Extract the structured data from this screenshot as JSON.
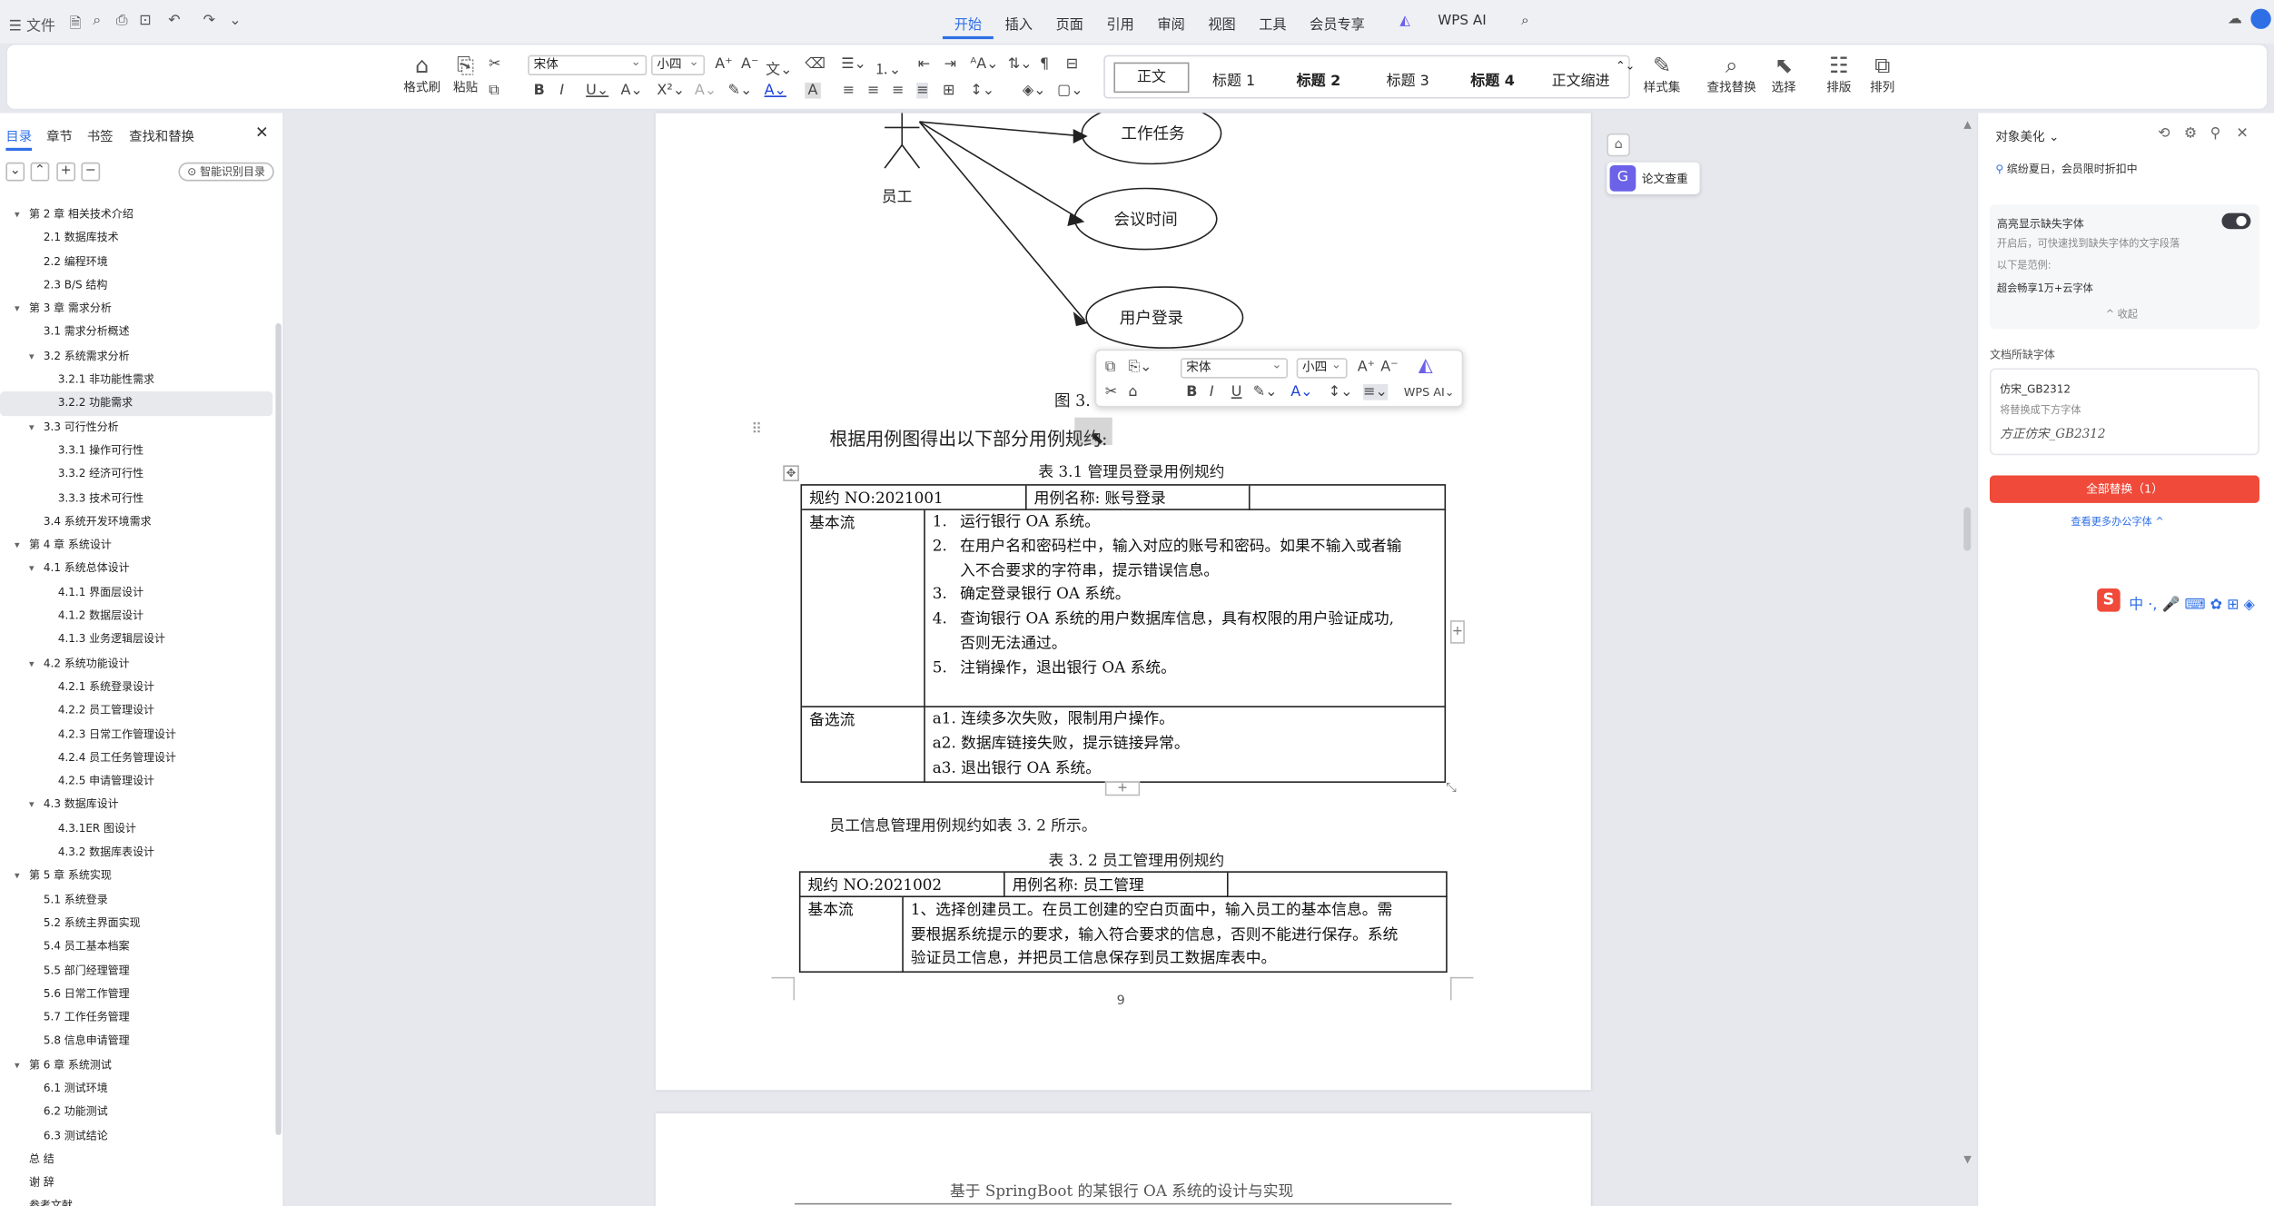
{
  "titlebar": {
    "file_label": "文件"
  },
  "menu": {
    "tabs": [
      "开始",
      "插入",
      "页面",
      "引用",
      "审阅",
      "视图",
      "工具",
      "会员专享"
    ],
    "active": "开始",
    "wps_ai": "WPS AI"
  },
  "ribbon": {
    "format_painter": "格式刷",
    "paste": "粘贴",
    "font_name": "宋体",
    "font_size": "小四",
    "styles": [
      "正文",
      "标题 1",
      "标题 2",
      "标题 3",
      "标题 4",
      "正文缩进"
    ],
    "style_set": "样式集",
    "find_replace": "查找替换",
    "select": "选择",
    "layout": "排版",
    "arrange": "排列"
  },
  "left_panel": {
    "tabs": [
      "目录",
      "章节",
      "书签",
      "查找和替换"
    ],
    "active_tab": "目录",
    "smart_toc": "智能识别目录",
    "toc": [
      {
        "label": "第 2 章  相关技术介绍",
        "level": 1,
        "open": true
      },
      {
        "label": "2.1  数据库技术",
        "level": 2
      },
      {
        "label": "2.2  编程环境",
        "level": 2
      },
      {
        "label": "2.3 B/S 结构",
        "level": 2
      },
      {
        "label": "第 3 章  需求分析",
        "level": 1,
        "open": true
      },
      {
        "label": "3.1  需求分析概述",
        "level": 2
      },
      {
        "label": "3.2  系统需求分析",
        "level": 2,
        "open": true
      },
      {
        "label": "3.2.1 非功能性需求",
        "level": 3
      },
      {
        "label": "3.2.2 功能需求",
        "level": 3,
        "selected": true
      },
      {
        "label": "3.3  可行性分析",
        "level": 2,
        "open": true
      },
      {
        "label": "3.3.1 操作可行性",
        "level": 3
      },
      {
        "label": "3.3.2 经济可行性",
        "level": 3
      },
      {
        "label": "3.3.3 技术可行性",
        "level": 3
      },
      {
        "label": "3.4  系统开发环境需求",
        "level": 2
      },
      {
        "label": "第 4 章  系统设计",
        "level": 1,
        "open": true
      },
      {
        "label": "4.1 系统总体设计",
        "level": 2,
        "open": true
      },
      {
        "label": "4.1.1 界面层设计",
        "level": 3
      },
      {
        "label": "4.1.2 数据层设计",
        "level": 3
      },
      {
        "label": "4.1.3 业务逻辑层设计",
        "level": 3
      },
      {
        "label": "4.2 系统功能设计",
        "level": 2,
        "open": true
      },
      {
        "label": "4.2.1 系统登录设计",
        "level": 3
      },
      {
        "label": "4.2.2 员工管理设计",
        "level": 3
      },
      {
        "label": "4.2.3 日常工作管理设计",
        "level": 3
      },
      {
        "label": "4.2.4 员工任务管理设计",
        "level": 3
      },
      {
        "label": "4.2.5 申请管理设计",
        "level": 3
      },
      {
        "label": "4.3  数据库设计",
        "level": 2,
        "open": true
      },
      {
        "label": "4.3.1ER 图设计",
        "level": 3
      },
      {
        "label": "4.3.2 数据库表设计",
        "level": 3
      },
      {
        "label": "第 5 章  系统实现",
        "level": 1,
        "open": true
      },
      {
        "label": "5.1 系统登录",
        "level": 2
      },
      {
        "label": "5.2 系统主界面实现",
        "level": 2
      },
      {
        "label": "5.4 员工基本档案",
        "level": 2
      },
      {
        "label": "5.5 部门经理管理",
        "level": 2
      },
      {
        "label": "5.6 日常工作管理",
        "level": 2
      },
      {
        "label": "5.7 工作任务管理",
        "level": 2
      },
      {
        "label": "5.8 信息申请管理",
        "level": 2
      },
      {
        "label": "第 6 章  系统测试",
        "level": 1,
        "open": true
      },
      {
        "label": "6.1  测试环境",
        "level": 2
      },
      {
        "label": "6.2  功能测试",
        "level": 2
      },
      {
        "label": "6.3  测试结论",
        "level": 2
      },
      {
        "label": "总  结",
        "level": 1
      },
      {
        "label": "谢  辞",
        "level": 1
      },
      {
        "label": "参考文献",
        "level": 1
      }
    ]
  },
  "document": {
    "diagram": {
      "actor": "员工",
      "cases": [
        "工作任务",
        "会议时间",
        "用户登录"
      ]
    },
    "figure_caption": "图 3.",
    "intro": "根据用例图得出以下部分用例规约:",
    "table1": {
      "caption": "表 3.1  管理员登录用例规约",
      "id_label": "规约 NO:2021001",
      "name_label": "用例名称:  账号登录",
      "basic_flow_label": "基本流",
      "basic_flow": [
        {
          "no": "1.",
          "text": "运行银行 OA 系统。"
        },
        {
          "no": "2.",
          "text": "在用户名和密码栏中，输入对应的账号和密码。如果不输入或者输",
          "cont": "入不合要求的字符串，提示错误信息。"
        },
        {
          "no": "3.",
          "text": "确定登录银行 OA 系统。"
        },
        {
          "no": "4.",
          "text": "查询银行 OA 系统的用户数据库信息，具有权限的用户验证成功,",
          "cont": "否则无法通过。"
        },
        {
          "no": "5.",
          "text": "注销操作，退出银行 OA 系统。"
        }
      ],
      "alt_flow_label": "备选流",
      "alt_flow": [
        "a1. 连续多次失败，限制用户操作。",
        "a2. 数据库链接失败，提示链接异常。",
        "a3. 退出银行 OA 系统。"
      ]
    },
    "para2": "员工信息管理用例规约如表 3. 2 所示。",
    "table2": {
      "caption": "表 3. 2  员工管理用例规约",
      "id_label": "规约 NO:2021002",
      "name_label": "用例名称:  员工管理",
      "basic_flow_label": "基本流",
      "basic_flow_lines": [
        "1、选择创建员工。在员工创建的空白页面中，输入员工的基本信息。需",
        "要根据系统提示的要求，输入符合要求的信息，否则不能进行保存。系统",
        "验证员工信息，并把员工信息保存到员工数据库表中。"
      ]
    },
    "page_number": "9",
    "next_page_header": "基于 SpringBoot 的某银行 OA 系统的设计与实现"
  },
  "float_toolbar": {
    "font": "宋体",
    "size": "小四",
    "wps_ai": "WPS AI"
  },
  "side_buttons": {
    "paper_check": "论文查重"
  },
  "right_panel": {
    "title": "对象美化",
    "promo": "缤纷夏日，会员限时折扣中",
    "highlight_missing": "高亮显示缺失字体",
    "highlight_desc": "开启后，可快速找到缺失字体的文字段落",
    "example_label": "以下是范例:",
    "example_text": "超会畅享1万+云字体",
    "collapse": "收起",
    "missing_fonts_label": "文档所缺字体",
    "missing_font": "仿宋_GB2312",
    "replace_hint": "将替换成下方字体",
    "replace_font": "方正仿宋_GB2312",
    "replace_all": "全部替换（1）",
    "more_fonts": "查看更多办公字体"
  },
  "colors": {
    "accent": "#2f6fe6",
    "replace_btn": "#f04a3a",
    "sidebar_btn": "#6b62e8"
  }
}
